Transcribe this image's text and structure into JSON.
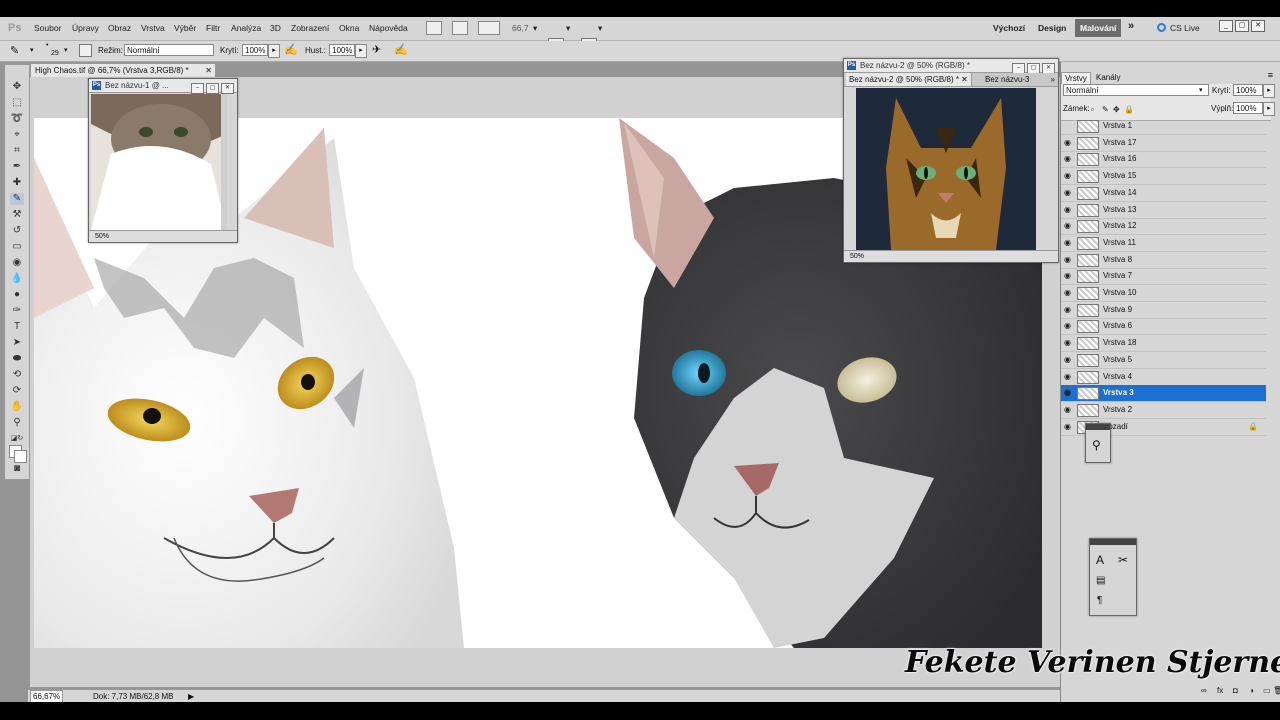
{
  "app": {
    "logo": "Ps"
  },
  "menu": [
    "Soubor",
    "Úpravy",
    "Obraz",
    "Vrstva",
    "Výběr",
    "Filtr",
    "Analýza",
    "3D",
    "Zobrazení",
    "Okna",
    "Nápověda"
  ],
  "zoom_field": "66,7",
  "workspaces": {
    "vychozi": "Výchozí",
    "design": "Design",
    "malovani": "Malování",
    "cslive": "CS Live"
  },
  "options": {
    "rezim_label": "Režim:",
    "rezim_value": "Normální",
    "kryti_label": "Krytí:",
    "kryti_value": "100%",
    "hust_label": "Hust.:",
    "hust_value": "100%",
    "brush_size": "29"
  },
  "document": {
    "tab_title": "High Chaos.tif @ 66,7% (Vrstva 3,RGB/8) *",
    "status_zoom": "66,67%",
    "status_doc": "Dok: 7,73 MB/62,8 MB"
  },
  "float1": {
    "title": "Bez názvu-1 @ ...",
    "zoom": "50%"
  },
  "float2": {
    "title": "Bez názvu-2 @ 50% (RGB/8) *",
    "tab1": "Bez názvu-2 @ 50% (RGB/8) *",
    "tab2": "Bez názvu-3",
    "zoom": "50%"
  },
  "layers_panel": {
    "tab_layers": "Vrstvy",
    "tab_channels": "Kanály",
    "blend_mode": "Normální",
    "opacity_label": "Krytí:",
    "opacity_value": "100%",
    "lock_label": "Zámek:",
    "fill_label": "Výplň:",
    "fill_value": "100%",
    "layers": [
      "Vrstva 1",
      "Vrstva 17",
      "Vrstva 16",
      "Vrstva 15",
      "Vrstva 14",
      "Vrstva 13",
      "Vrstva 12",
      "Vrstva 11",
      "Vrstva 8",
      "Vrstva 7",
      "Vrstva 10",
      "Vrstva 9",
      "Vrstva 6",
      "Vrstva 18",
      "Vrstva 5",
      "Vrstva 4",
      "Vrstva 3",
      "Vrstva 2",
      "Pozadí"
    ],
    "selected_layer": "Vrstva 3"
  },
  "watermark": "Fekete Verinen Stjerne",
  "colors": {
    "selection": "#1d6fd1",
    "menubar": "#d6d6d6",
    "workspace": "#959595"
  }
}
